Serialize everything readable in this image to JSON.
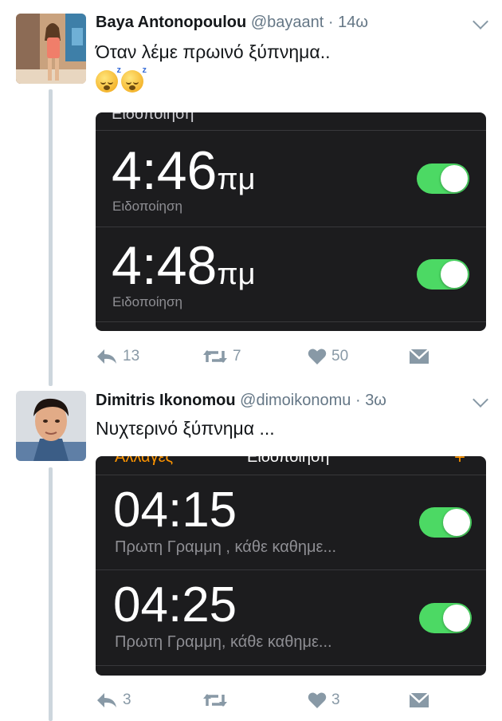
{
  "colors": {
    "accent_toggle": "#4cd964",
    "meta": "#8899a6",
    "media_bg": "#1c1c1e",
    "orange": "#ff9500"
  },
  "tweets": [
    {
      "name": "Baya Antonopoulou",
      "handle": "@bayaant",
      "sep": "·",
      "time": "14ω",
      "text": "Όταν λέμε πρωινό ξύπνημα..",
      "media": {
        "top_cut": "Ειδοποίηση",
        "alarms": [
          {
            "time": "4:46",
            "ampm": "πμ",
            "label": "Ειδοποίηση",
            "enabled": true
          },
          {
            "time": "4:48",
            "ampm": "πμ",
            "label": "Ειδοποίηση",
            "enabled": true
          }
        ]
      },
      "actions": {
        "reply_icon": "reply-icon",
        "replies": "13",
        "retweet_icon": "retweet-icon",
        "retweets": "7",
        "like_icon": "heart-icon",
        "likes": "50",
        "dm_icon": "message-icon"
      }
    },
    {
      "name": "Dimitris Ikonomou",
      "handle": "@dimoikonomu",
      "sep": "·",
      "time": "3ω",
      "text": "Νυχτερινό ξύπνημα ...",
      "media": {
        "top_left": "Αλλαγές",
        "top_center": "Ειδοποίηση",
        "top_right": "+",
        "alarms": [
          {
            "time": "04:15",
            "label": "Πρωτη Γραμμη , κάθε καθημε...",
            "enabled": true
          },
          {
            "time": "04:25",
            "label": "Πρωτη Γραμμη, κάθε καθημε...",
            "enabled": true
          }
        ]
      },
      "actions": {
        "reply_icon": "reply-icon",
        "replies": "3",
        "retweet_icon": "retweet-icon",
        "likes": "3",
        "like_icon": "heart-icon",
        "dm_icon": "message-icon"
      }
    }
  ]
}
